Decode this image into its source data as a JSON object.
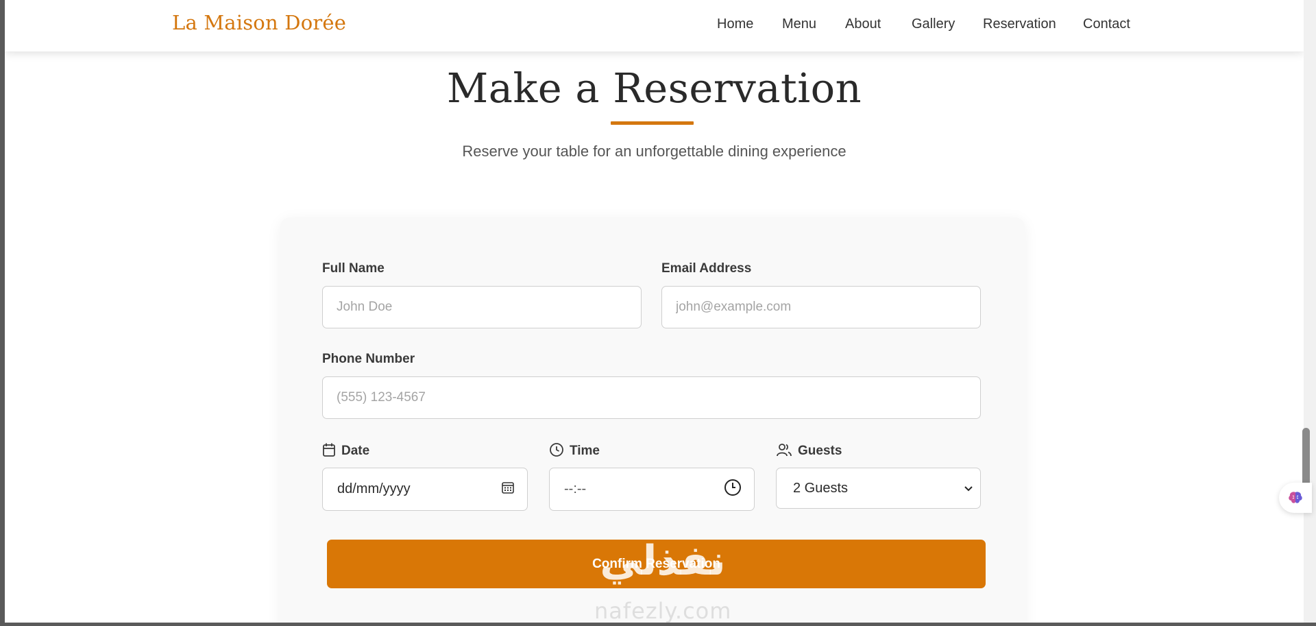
{
  "header": {
    "brand": "La Maison Dorée",
    "nav": [
      {
        "id": "home",
        "label": "Home"
      },
      {
        "id": "menu",
        "label": "Menu"
      },
      {
        "id": "about",
        "label": "About"
      },
      {
        "id": "gallery",
        "label": "Gallery"
      },
      {
        "id": "reservation",
        "label": "Reservation"
      },
      {
        "id": "contact",
        "label": "Contact"
      }
    ]
  },
  "hero": {
    "title": "Make a Reservation",
    "subtitle": "Reserve your table for an unforgettable dining experience"
  },
  "form": {
    "full_name": {
      "label": "Full Name",
      "placeholder": "John Doe",
      "value": ""
    },
    "email": {
      "label": "Email Address",
      "placeholder": "john@example.com",
      "value": ""
    },
    "phone": {
      "label": "Phone Number",
      "placeholder": "(555) 123-4567",
      "value": ""
    },
    "date": {
      "label": "Date",
      "placeholder": "dd/mm/yyyy",
      "icon": "calendar-icon"
    },
    "time": {
      "label": "Time",
      "placeholder": "--:--",
      "icon": "clock-icon"
    },
    "guests": {
      "label": "Guests",
      "selected": "2 Guests",
      "icon": "users-icon"
    },
    "submit_label": "Confirm Reservation"
  },
  "watermark": {
    "arabic": "نفذلي",
    "latin": "nafezly.com"
  },
  "colors": {
    "accent": "#d97706",
    "brand": "#d4770f",
    "heading": "#2a2a2a",
    "card_bg": "#f9f9f9"
  }
}
